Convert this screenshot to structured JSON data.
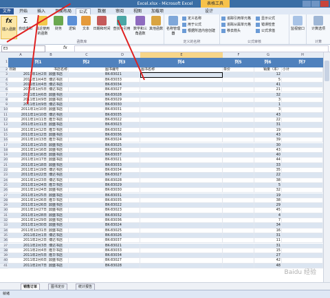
{
  "window": {
    "title": "Excel.xlsx - Microsoft Excel",
    "context_tab": "表格工具"
  },
  "tabs": [
    "文件",
    "开始",
    "插入",
    "页面布局",
    "公式",
    "数据",
    "审阅",
    "视图",
    "加载项",
    "设计"
  ],
  "active_tab": "公式",
  "ribbon": {
    "insert_function": "插入函数",
    "autosum": "自动求和",
    "recent": "最近使用的函数",
    "financial": "财务",
    "logical": "逻辑",
    "text": "文本",
    "datetime": "日期和时间",
    "lookup": "查找与引用",
    "math": "数学和三角函数",
    "more": "其他函数",
    "group_library": "函数库",
    "name_manager": "名称管理器",
    "define_name": "定义名称",
    "use_in_formula": "用于公式",
    "create_from_selection": "根据所选内容创建",
    "group_names": "定义的名称",
    "trace_precedents": "追踪引用单元格",
    "trace_dependents": "追踪从属单元格",
    "remove_arrows": "移去箭头",
    "show_formulas": "显示公式",
    "error_checking": "错误检查",
    "evaluate_formula": "公式求值",
    "group_auditing": "公式审核",
    "watch_window": "监视窗口",
    "calc_options": "计算选项",
    "group_calc": "计算"
  },
  "formula_bar": {
    "name_box": "E3",
    "fx": "fx",
    "value": ""
  },
  "columns": [
    "A",
    "B",
    "C",
    "D",
    "E",
    "F",
    "G",
    "H"
  ],
  "table_headers": [
    "列1",
    "列2",
    "列3",
    "列4",
    "列5",
    "列6",
    "列7"
  ],
  "field_row": [
    "日期",
    "书店名称",
    "图书编号",
    "图书名称",
    "单价",
    "销量（本）",
    "小计"
  ],
  "rows": [
    [
      "2011年1月2日",
      "鼎盛书店",
      "BK-83021",
      "12"
    ],
    [
      "2011年1月4日",
      "博达书店",
      "BK-83033",
      "5"
    ],
    [
      "2011年1月4日",
      "博达书店",
      "BK-83034",
      "41"
    ],
    [
      "2011年1月5日",
      "博达书店",
      "BK-83027",
      "21"
    ],
    [
      "2011年1月6日",
      "鼎盛书店",
      "BK-83028",
      "32"
    ],
    [
      "2011年1月9日",
      "鼎盛书店",
      "BK-83029",
      "3"
    ],
    [
      "2011年1月9日",
      "博达书店",
      "BK-83030",
      "1"
    ],
    [
      "2011年1月10日",
      "鼎盛书店",
      "BK-83031",
      "3"
    ],
    [
      "2011年1月10日",
      "博达书店",
      "BK-83035",
      "43"
    ],
    [
      "2011年1月11日",
      "隆华书店",
      "BK-83022",
      "22"
    ],
    [
      "2011年1月11日",
      "鼎盛书店",
      "BK-83023",
      "31"
    ],
    [
      "2011年1月12日",
      "隆华书店",
      "BK-83032",
      "19"
    ],
    [
      "2011年1月12日",
      "鼎盛书店",
      "BK-83036",
      "43"
    ],
    [
      "2011年1月13日",
      "隆华书店",
      "BK-83024",
      "39"
    ],
    [
      "2011年1月15日",
      "鼎盛书店",
      "BK-83025",
      "30"
    ],
    [
      "2011年1月16日",
      "鼎盛书店",
      "BK-83026",
      "43"
    ],
    [
      "2011年1月16日",
      "鼎盛书店",
      "BK-83037",
      "40"
    ],
    [
      "2011年1月17日",
      "鼎盛书店",
      "BK-83021",
      "44"
    ],
    [
      "2011年1月18日",
      "鼎盛书店",
      "BK-83033",
      "33"
    ],
    [
      "2011年1月19日",
      "博达书店",
      "BK-83034",
      "35"
    ],
    [
      "2011年1月22日",
      "博达书店",
      "BK-83027",
      "22"
    ],
    [
      "2011年1月23日",
      "博达书店",
      "BK-83028",
      "38"
    ],
    [
      "2011年1月24日",
      "隆华书店",
      "BK-83029",
      "5"
    ],
    [
      "2011年1月24日",
      "鼎盛书店",
      "BK-83030",
      "32"
    ],
    [
      "2011年1月25日",
      "鼎盛书店",
      "BK-83031",
      "19"
    ],
    [
      "2011年1月26日",
      "隆华书店",
      "BK-83035",
      "38"
    ],
    [
      "2011年1月26日",
      "鼎盛书店",
      "BK-83022",
      "29"
    ],
    [
      "2011年1月27日",
      "鼎盛书店",
      "BK-83023",
      "45"
    ],
    [
      "2011年1月28日",
      "鼎盛书店",
      "BK-83032",
      "4"
    ],
    [
      "2011年1月29日",
      "鼎盛书店",
      "BK-83036",
      "7"
    ],
    [
      "2011年1月30日",
      "鼎盛书店",
      "BK-83024",
      "34"
    ],
    [
      "2011年1月31日",
      "鼎盛书店",
      "BK-83025",
      "16"
    ],
    [
      "2011年2月1日",
      "博达书店",
      "BK-83026",
      "31"
    ],
    [
      "2011年2月2日",
      "博达书店",
      "BK-83037",
      "11"
    ],
    [
      "2011年2月3日",
      "博达书店",
      "BK-83021",
      "31"
    ],
    [
      "2011年2月4日",
      "隆华书店",
      "BK-83033",
      "15"
    ],
    [
      "2011年2月5日",
      "隆华书店",
      "BK-83034",
      "27"
    ],
    [
      "2011年2月6日",
      "鼎盛书店",
      "BK-83027",
      "42"
    ],
    [
      "2011年2月7日",
      "鼎盛书店",
      "BK-83028",
      "48"
    ]
  ],
  "row_numbers_start": 1,
  "sheet_tabs": [
    "销售订单",
    "图书定价",
    "统计报告"
  ],
  "status": "就绪",
  "watermark": "Baidu 经验"
}
